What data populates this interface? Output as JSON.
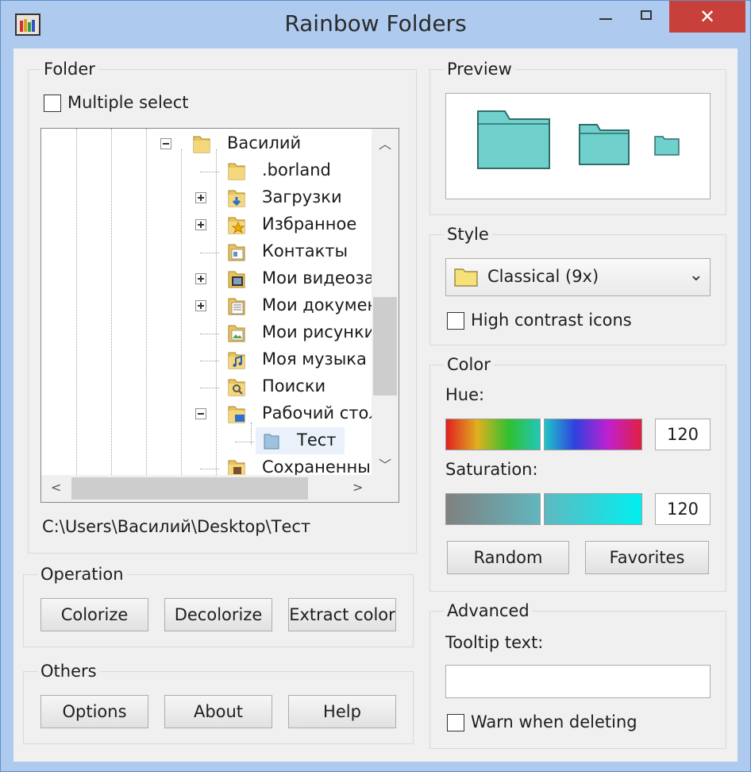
{
  "window": {
    "title": "Rainbow Folders",
    "close_glyph": "✕",
    "icon": "rainbow-folders-app-icon"
  },
  "folder": {
    "label": "Folder",
    "multiple_select_label": "Multiple select",
    "multiple_select_checked": false,
    "tree": [
      {
        "text": "Василий",
        "icon": "folder-icon",
        "expander": "minus"
      },
      {
        "text": ".borland",
        "icon": "folder-icon",
        "expander": ""
      },
      {
        "text": "Загрузки",
        "icon": "downloads-folder-icon",
        "expander": "plus"
      },
      {
        "text": "Избранное",
        "icon": "favorites-folder-icon",
        "expander": "plus"
      },
      {
        "text": "Контакты",
        "icon": "contacts-folder-icon",
        "expander": ""
      },
      {
        "text": "Мои видеозаг",
        "icon": "videos-folder-icon",
        "expander": "plus"
      },
      {
        "text": "Мои докумен",
        "icon": "documents-folder-icon",
        "expander": "plus"
      },
      {
        "text": "Мои рисунки",
        "icon": "pictures-folder-icon",
        "expander": ""
      },
      {
        "text": "Моя музыка",
        "icon": "music-folder-icon",
        "expander": ""
      },
      {
        "text": "Поиски",
        "icon": "searches-folder-icon",
        "expander": ""
      },
      {
        "text": "Рабочий стол",
        "icon": "desktop-folder-icon",
        "expander": "minus"
      },
      {
        "text": "Тест",
        "icon": "folder-icon",
        "expander": ""
      },
      {
        "text": "Сохраненные",
        "icon": "saved-folder-icon",
        "expander": ""
      }
    ],
    "path": "C:\\Users\\Василий\\Desktop\\Тест"
  },
  "operation": {
    "label": "Operation",
    "colorize": "Colorize",
    "decolorize": "Decolorize",
    "extract_color": "Extract color"
  },
  "others": {
    "label": "Others",
    "options": "Options",
    "about": "About",
    "help": "Help"
  },
  "preview": {
    "label": "Preview",
    "folder_color": "#6fd0cc"
  },
  "style": {
    "label": "Style",
    "selected": "Classical (9x)",
    "high_contrast_label": "High contrast icons",
    "high_contrast_checked": false
  },
  "color": {
    "label": "Color",
    "hue_label": "Hue:",
    "hue_value": "120",
    "saturation_label": "Saturation:",
    "saturation_value": "120",
    "random": "Random",
    "favorites": "Favorites"
  },
  "advanced": {
    "label": "Advanced",
    "tooltip_label": "Tooltip text:",
    "tooltip_value": "",
    "warn_label": "Warn when deleting",
    "warn_checked": false
  }
}
